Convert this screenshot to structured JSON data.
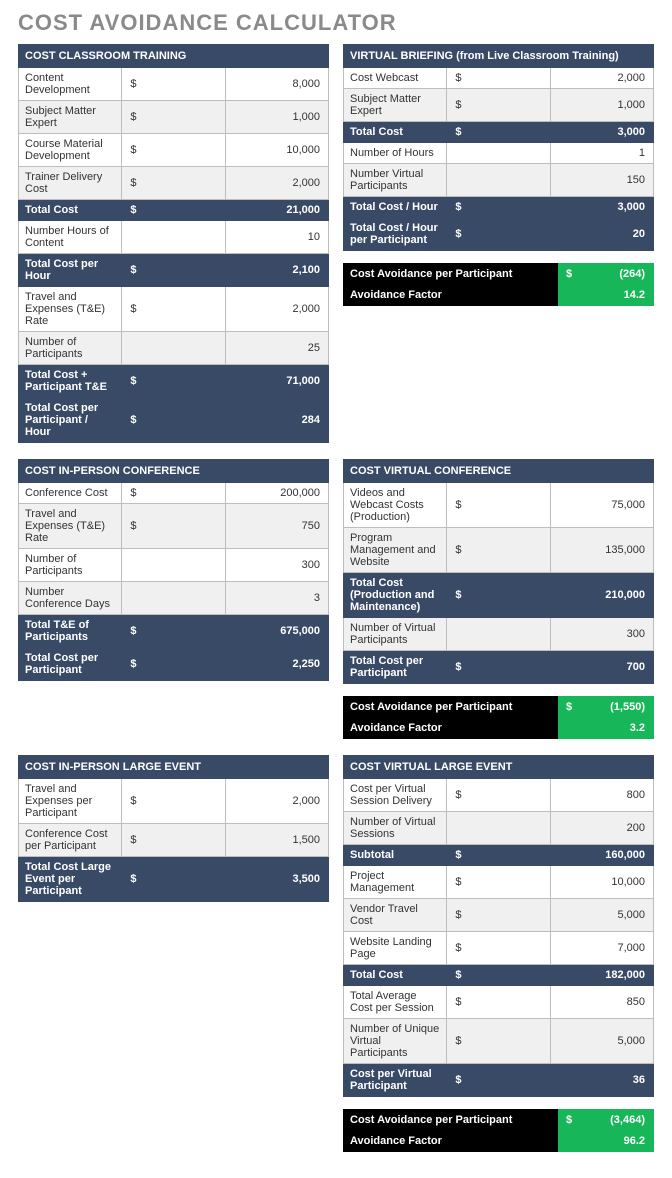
{
  "title": "COST AVOIDANCE CALCULATOR",
  "sections": [
    {
      "left": {
        "header": "COST CLASSROOM TRAINING",
        "rows": [
          {
            "style": "normal",
            "label": "Content Development",
            "cur": "$",
            "val": "8,000"
          },
          {
            "style": "alt",
            "label": "Subject Matter Expert",
            "cur": "$",
            "val": "1,000"
          },
          {
            "style": "normal",
            "label": "Course Material Development",
            "cur": "$",
            "val": "10,000"
          },
          {
            "style": "alt",
            "label": "Trainer Delivery Cost",
            "cur": "$",
            "val": "2,000"
          },
          {
            "style": "total",
            "label": "Total Cost",
            "cur": "$",
            "val": "21,000"
          },
          {
            "style": "normal",
            "label": "Number Hours of Content",
            "cur": "",
            "val": "10"
          },
          {
            "style": "total",
            "label": "Total Cost per Hour",
            "cur": "$",
            "val": "2,100"
          },
          {
            "style": "normal",
            "label": "Travel and Expenses (T&E) Rate",
            "cur": "$",
            "val": "2,000"
          },
          {
            "style": "alt",
            "label": "Number of Participants",
            "cur": "",
            "val": "25"
          },
          {
            "style": "total",
            "label": "Total Cost + Participant T&E",
            "cur": "$",
            "val": "71,000"
          },
          {
            "style": "total",
            "label": "Total Cost per Participant / Hour",
            "cur": "$",
            "val": "284"
          }
        ]
      },
      "right": {
        "header": "VIRTUAL BRIEFING (from Live Classroom Training)",
        "rows": [
          {
            "style": "normal",
            "label": "Cost Webcast",
            "cur": "$",
            "val": "2,000"
          },
          {
            "style": "alt",
            "label": "Subject Matter Expert",
            "cur": "$",
            "val": "1,000"
          },
          {
            "style": "total",
            "label": "Total Cost",
            "cur": "$",
            "val": "3,000"
          },
          {
            "style": "normal",
            "label": "Number of Hours",
            "cur": "",
            "val": "1"
          },
          {
            "style": "alt",
            "label": "Number Virtual Participants",
            "cur": "",
            "val": "150"
          },
          {
            "style": "total",
            "label": "Total Cost / Hour",
            "cur": "$",
            "val": "3,000"
          },
          {
            "style": "total",
            "label": "Total Cost / Hour per Participant",
            "cur": "$",
            "val": "20"
          }
        ],
        "result": {
          "avoidance_label": "Cost Avoidance per Participant",
          "avoidance_cur": "$",
          "avoidance_val": "(264)",
          "factor_label": "Avoidance Factor",
          "factor_val": "14.2"
        }
      }
    },
    {
      "left": {
        "header": "COST IN-PERSON CONFERENCE",
        "rows": [
          {
            "style": "normal",
            "label": "Conference Cost",
            "cur": "$",
            "val": "200,000"
          },
          {
            "style": "alt",
            "label": "Travel and Expenses (T&E) Rate",
            "cur": "$",
            "val": "750"
          },
          {
            "style": "normal",
            "label": "Number of Participants",
            "cur": "",
            "val": "300"
          },
          {
            "style": "alt",
            "label": "Number Conference Days",
            "cur": "",
            "val": "3"
          },
          {
            "style": "total",
            "label": "Total T&E of Participants",
            "cur": "$",
            "val": "675,000"
          },
          {
            "style": "total",
            "label": "Total Cost per Participant",
            "cur": "$",
            "val": "2,250"
          }
        ]
      },
      "right": {
        "header": "COST VIRTUAL CONFERENCE",
        "rows": [
          {
            "style": "normal",
            "label": "Videos and Webcast Costs (Production)",
            "cur": "$",
            "val": "75,000"
          },
          {
            "style": "alt",
            "label": "Program Management and Website",
            "cur": "$",
            "val": "135,000"
          },
          {
            "style": "total",
            "label": "Total Cost (Production and Maintenance)",
            "cur": "$",
            "val": "210,000"
          },
          {
            "style": "alt",
            "label": "Number of Virtual Participants",
            "cur": "",
            "val": "300"
          },
          {
            "style": "total",
            "label": "Total Cost per Participant",
            "cur": "$",
            "val": "700"
          }
        ],
        "result": {
          "avoidance_label": "Cost Avoidance per Participant",
          "avoidance_cur": "$",
          "avoidance_val": "(1,550)",
          "factor_label": "Avoidance Factor",
          "factor_val": "3.2"
        }
      }
    },
    {
      "left": {
        "header": "COST IN-PERSON LARGE EVENT",
        "rows": [
          {
            "style": "normal",
            "label": "Travel and Expenses per Participant",
            "cur": "$",
            "val": "2,000"
          },
          {
            "style": "alt",
            "label": "Conference Cost per Participant",
            "cur": "$",
            "val": "1,500"
          },
          {
            "style": "total",
            "label": "Total Cost Large Event per Participant",
            "cur": "$",
            "val": "3,500"
          }
        ]
      },
      "right": {
        "header": "COST VIRTUAL LARGE EVENT",
        "rows": [
          {
            "style": "normal",
            "label": "Cost per Virtual Session Delivery",
            "cur": "$",
            "val": "800"
          },
          {
            "style": "alt",
            "label": "Number of Virtual Sessions",
            "cur": "",
            "val": "200"
          },
          {
            "style": "total",
            "label": "Subtotal",
            "cur": "$",
            "val": "160,000"
          },
          {
            "style": "normal",
            "label": "Project Management",
            "cur": "$",
            "val": "10,000"
          },
          {
            "style": "alt",
            "label": "Vendor Travel Cost",
            "cur": "$",
            "val": "5,000"
          },
          {
            "style": "normal",
            "label": "Website Landing Page",
            "cur": "$",
            "val": "7,000"
          },
          {
            "style": "total",
            "label": "Total Cost",
            "cur": "$",
            "val": "182,000"
          },
          {
            "style": "normal",
            "label": "Total Average Cost per Session",
            "cur": "$",
            "val": "850"
          },
          {
            "style": "alt",
            "label": "Number of Unique Virtual Participants",
            "cur": "$",
            "val": "5,000"
          },
          {
            "style": "total",
            "label": "Cost per Virtual Participant",
            "cur": "$",
            "val": "36"
          }
        ],
        "result": {
          "avoidance_label": "Cost Avoidance per Participant",
          "avoidance_cur": "$",
          "avoidance_val": "(3,464)",
          "factor_label": "Avoidance Factor",
          "factor_val": "96.2"
        }
      }
    }
  ]
}
